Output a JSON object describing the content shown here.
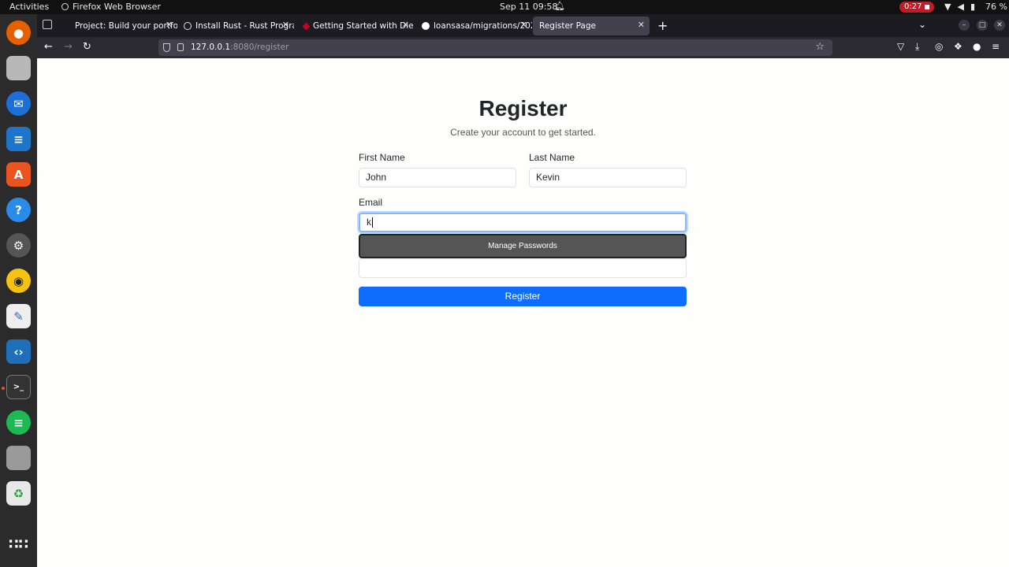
{
  "topbar": {
    "activities": "Activities",
    "app_name": "Firefox Web Browser",
    "clock": "Sep 11  09:58",
    "recording_time": "0:27",
    "battery": "76 %"
  },
  "dock": {
    "items": [
      "firefox",
      "files",
      "thunderbird",
      "libreoffice-writer",
      "app-center",
      "help",
      "settings",
      "rhythmbox",
      "text-editor",
      "vscode",
      "terminal",
      "spotify",
      "archive",
      "trash",
      "show-apps"
    ]
  },
  "tabs": [
    {
      "label": "Project: Build your portfo",
      "active": false
    },
    {
      "label": "Install Rust - Rust Progra",
      "active": false
    },
    {
      "label": "Getting Started with Die",
      "active": false
    },
    {
      "label": "loansasa/migrations/202",
      "active": false
    },
    {
      "label": "Register Page",
      "active": true
    }
  ],
  "urlbar": {
    "host": "127.0.0.1",
    "path": ":8080/register"
  },
  "form": {
    "title": "Register",
    "subtitle": "Create your account to get started.",
    "first_name_label": "First Name",
    "first_name_value": "John",
    "last_name_label": "Last Name",
    "last_name_value": "Kevin",
    "email_label": "Email",
    "email_value": "k",
    "autocomplete_option": "Manage Passwords",
    "submit_label": "Register"
  },
  "colors": {
    "primary_button": "#0d6efd",
    "recording_badge": "#c01c28"
  }
}
